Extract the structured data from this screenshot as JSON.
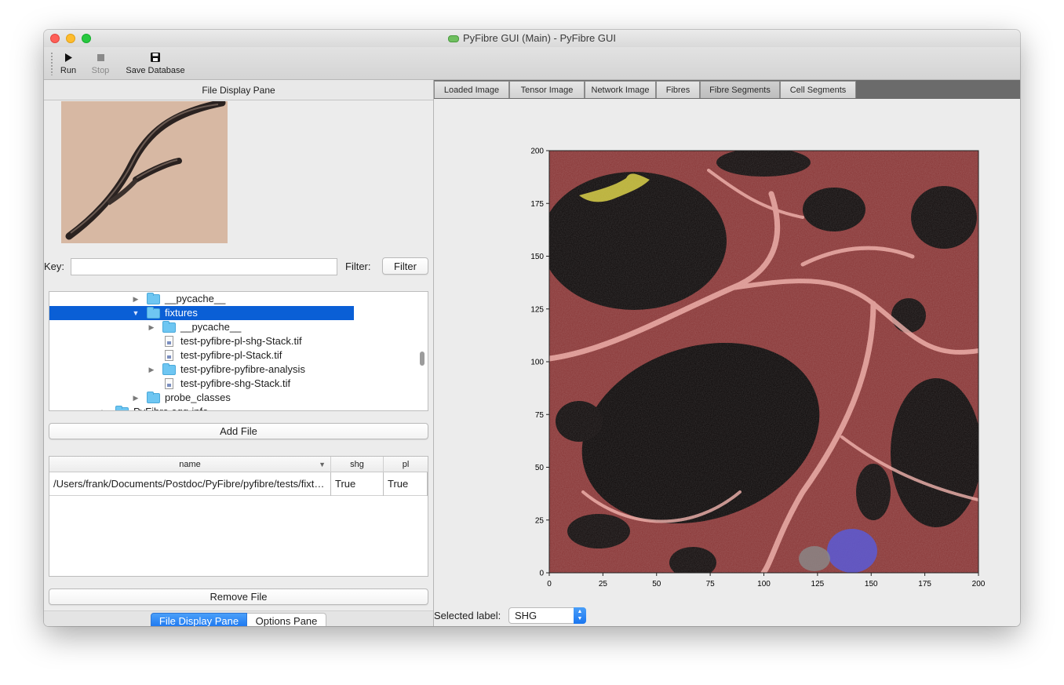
{
  "window": {
    "title": "PyFibre GUI (Main) - PyFibre GUI"
  },
  "toolbar": {
    "run_label": "Run",
    "stop_label": "Stop",
    "save_label": "Save Database"
  },
  "left": {
    "pane_title": "File Display Pane",
    "key_label": "Key:",
    "key_value": "",
    "filter_label": "Filter:",
    "filter_button": "Filter",
    "tree": [
      {
        "label": "__pycache__",
        "type": "folder",
        "expanded": false
      },
      {
        "label": "fixtures",
        "type": "folder",
        "expanded": true,
        "selected": true
      },
      {
        "label": "__pycache__",
        "type": "folder",
        "expanded": false
      },
      {
        "label": "test-pyfibre-pl-shg-Stack.tif",
        "type": "file"
      },
      {
        "label": "test-pyfibre-pl-Stack.tif",
        "type": "file"
      },
      {
        "label": "test-pyfibre-pyfibre-analysis",
        "type": "folder",
        "expanded": false
      },
      {
        "label": "test-pyfibre-shg-Stack.tif",
        "type": "file"
      },
      {
        "label": "probe_classes",
        "type": "folder",
        "expanded": false
      },
      {
        "label": "PyFibre.egg-info",
        "type": "folder",
        "expanded": false
      }
    ],
    "add_file": "Add File",
    "table": {
      "columns": [
        "name",
        "shg",
        "pl"
      ],
      "rows": [
        [
          "/Users/frank/Documents/Postdoc/PyFibre/pyfibre/tests/fixt…",
          "True",
          "True"
        ]
      ]
    },
    "remove_file": "Remove File",
    "bottom_tabs": [
      "File Display Pane",
      "Options Pane"
    ]
  },
  "right": {
    "tabs": [
      "Loaded Image",
      "Tensor Image",
      "Network Image",
      "Fibres",
      "Fibre Segments",
      "Cell Segments"
    ],
    "active_tab": "Fibre Segments",
    "selected_label_caption": "Selected label:",
    "selected_label_value": "SHG"
  },
  "chart_data": {
    "type": "heatmap",
    "title": "",
    "xlabel": "",
    "ylabel": "",
    "xlim": [
      0,
      200
    ],
    "ylim": [
      0,
      200
    ],
    "xticks": [
      0,
      25,
      50,
      75,
      100,
      125,
      150,
      175,
      200
    ],
    "yticks": [
      0,
      25,
      50,
      75,
      100,
      125,
      150,
      175,
      200
    ],
    "overlay_colors": {
      "fibre": "#c0504d",
      "cell": "#5b5bd6",
      "highlight": "#d9d04a"
    }
  },
  "icons": {
    "run": "play-icon",
    "stop": "stop-icon",
    "save": "floppy-icon"
  }
}
